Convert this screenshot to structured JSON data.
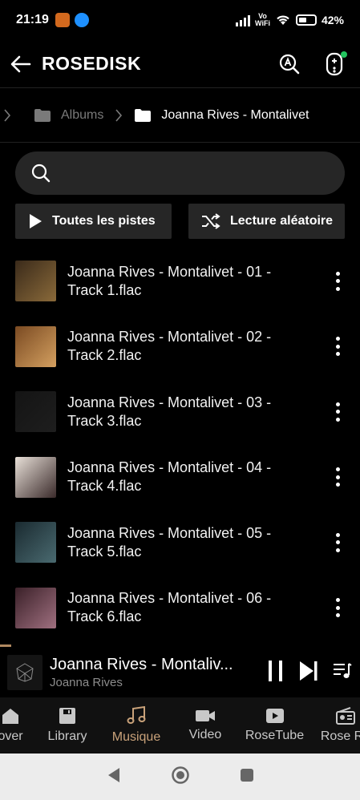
{
  "status_bar": {
    "time": "21:19",
    "vowifi_top": "Vo",
    "vowifi_bottom": "WiFi",
    "battery": "42%"
  },
  "app_bar": {
    "title": "ROSEDISK"
  },
  "breadcrumb": {
    "items": [
      "Albums",
      "Joanna Rives - Montalivet"
    ]
  },
  "search": {
    "placeholder": "",
    "value": ""
  },
  "actions": {
    "play_all": "Toutes les pistes",
    "shuffle": "Lecture aléatoire"
  },
  "tracks": [
    {
      "title": "Joanna Rives - Montalivet - 01 - Track 1.flac",
      "thumb_colors": [
        "#3a2a1a",
        "#8a6a3a"
      ]
    },
    {
      "title": "Joanna Rives - Montalivet - 02 - Track 2.flac",
      "thumb_colors": [
        "#7a4a22",
        "#d4a060"
      ]
    },
    {
      "title": "Joanna Rives - Montalivet - 03 - Track 3.flac",
      "thumb_colors": [
        "#141414",
        "#1e1e1e"
      ]
    },
    {
      "title": "Joanna Rives - Montalivet - 04 - Track 4.flac",
      "thumb_colors": [
        "#e8e0d8",
        "#3a2a2a"
      ]
    },
    {
      "title": "Joanna Rives - Montalivet - 05 - Track 5.flac",
      "thumb_colors": [
        "#1a2a30",
        "#4a6a70"
      ]
    },
    {
      "title": "Joanna Rives - Montalivet - 06 - Track 6.flac",
      "thumb_colors": [
        "#3a2028",
        "#a07080"
      ]
    }
  ],
  "now_playing": {
    "title": "Joanna Rives - Montaliv...",
    "artist": "Joanna Rives"
  },
  "bottom_nav": {
    "items": [
      {
        "label": "over",
        "icon": "home-icon"
      },
      {
        "label": "Library",
        "icon": "library-icon"
      },
      {
        "label": "Musique",
        "icon": "music-note-icon",
        "active": true
      },
      {
        "label": "Video",
        "icon": "video-camera-icon"
      },
      {
        "label": "RoseTube",
        "icon": "rosetube-icon"
      },
      {
        "label": "Rose Ra",
        "icon": "radio-icon"
      }
    ]
  },
  "colors": {
    "accent": "#c9a27a",
    "background": "#000000",
    "surface": "#262626",
    "inactive_text": "#7a7a7a",
    "online_dot": "#22c55e"
  }
}
